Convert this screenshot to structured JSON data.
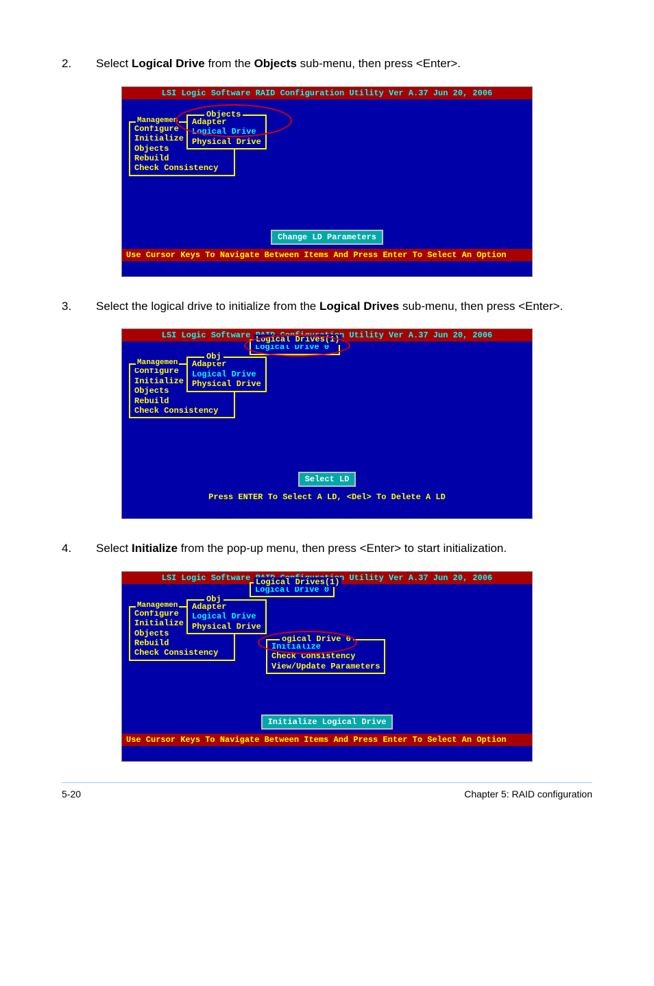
{
  "steps": {
    "s2": {
      "num": "2.",
      "text_before": "Select ",
      "bold1": "Logical Drive",
      "mid": " from the ",
      "bold2": "Objects",
      "text_after": " sub-menu, then press <Enter>."
    },
    "s3": {
      "num": "3.",
      "text_before": "Select the logical drive to initialize from the ",
      "bold1": "Logical Drives",
      "text_after": " sub-menu, then press <Enter>."
    },
    "s4": {
      "num": "4.",
      "text_before": "Select ",
      "bold1": "Initialize",
      "text_after": " from the pop-up menu, then press <Enter> to start initialization."
    }
  },
  "bios": {
    "title": "LSI Logic Software RAID Configuration Utility Ver A.37 Jun 20, 2006",
    "mgmt_title": "Managemen",
    "mgmt_items": [
      "Configure",
      "Initialize",
      "Objects",
      "Rebuild",
      "Check Consistency"
    ],
    "obj_title": "Objects",
    "obj_title_short": "Obj",
    "obj_items": [
      "Adapter",
      "Logical Drive",
      "Physical Drive"
    ],
    "ld_title": "Logical Drives(1)",
    "ld_item": "Logical Drive 0",
    "action_title": "ogical Drive 0",
    "action_items": [
      "Initialize",
      "Check Consistency",
      "View/Update Parameters"
    ],
    "status1": "Change LD Parameters",
    "status2": "Select LD",
    "status3": "Initialize Logical Drive",
    "help1": "Use Cursor Keys To Navigate Between Items And Press Enter To Select An Option",
    "help2": "Press ENTER To Select A LD, <Del> To Delete A LD"
  },
  "footer": {
    "left": "5-20",
    "right": "Chapter 5: RAID configuration"
  }
}
